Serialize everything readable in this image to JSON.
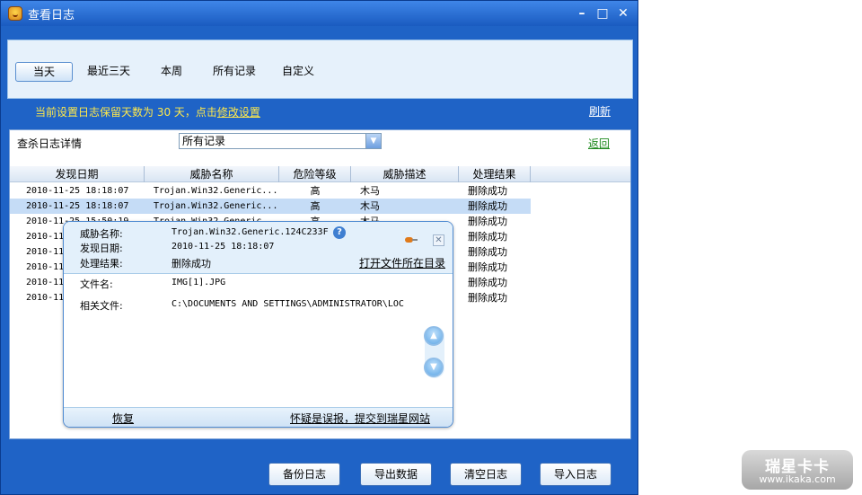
{
  "window": {
    "title": "查看日志"
  },
  "tabs": [
    {
      "label": "当天",
      "active": true
    },
    {
      "label": "最近三天"
    },
    {
      "label": "本周"
    },
    {
      "label": "所有记录"
    },
    {
      "label": "自定义"
    }
  ],
  "retention": {
    "prefix": "当前设置日志保留天数为 30 天，点击",
    "link": "修改设置"
  },
  "refresh_label": "刷新",
  "filter": {
    "label": "查杀日志详情",
    "selected": "所有记录"
  },
  "back_label": "返回",
  "table": {
    "columns": [
      "发现日期",
      "威胁名称",
      "危险等级",
      "威胁描述",
      "处理结果"
    ],
    "rows": [
      {
        "date": "2010-11-25 18:18:07",
        "name": "Trojan.Win32.Generic...",
        "level": "高",
        "desc": "木马",
        "result": "删除成功"
      },
      {
        "date": "2010-11-25 18:18:07",
        "name": "Trojan.Win32.Generic...",
        "level": "高",
        "desc": "木马",
        "result": "删除成功",
        "selected": true
      },
      {
        "date": "2010-11-25 15:50:19",
        "name": "Trojan.Win32.Generic...",
        "level": "高",
        "desc": "木马",
        "result": "删除成功"
      },
      {
        "date": "2010-11",
        "name": "",
        "level": "",
        "desc": "",
        "result": "删除成功"
      },
      {
        "date": "2010-11",
        "name": "",
        "level": "",
        "desc": "",
        "result": "删除成功"
      },
      {
        "date": "2010-11",
        "name": "",
        "level": "",
        "desc": "",
        "result": "删除成功"
      },
      {
        "date": "2010-11",
        "name": "",
        "level": "",
        "desc": "",
        "result": "删除成功"
      },
      {
        "date": "2010-11",
        "name": "",
        "level": "",
        "desc": "",
        "result": "删除成功"
      }
    ]
  },
  "popup": {
    "threat_label": "威胁名称:",
    "threat_value": "Trojan.Win32.Generic.124C233F",
    "date_label": "发现日期:",
    "date_value": "2010-11-25 18:18:07",
    "result_label": "处理结果:",
    "result_value": "删除成功",
    "open_folder": "打开文件所在目录",
    "file_label": "文件名:",
    "file_value": "IMG[1].JPG",
    "related_label": "相关文件:",
    "related_value": "C:\\DOCUMENTS AND SETTINGS\\ADMINISTRATOR\\LOC",
    "restore": "恢复",
    "report": "怀疑是误报，提交到瑞星网站"
  },
  "buttons": [
    "备份日志",
    "导出数据",
    "清空日志",
    "导入日志"
  ],
  "watermark": {
    "text": "瑞星卡卡",
    "url": "www.ikaka.com"
  }
}
